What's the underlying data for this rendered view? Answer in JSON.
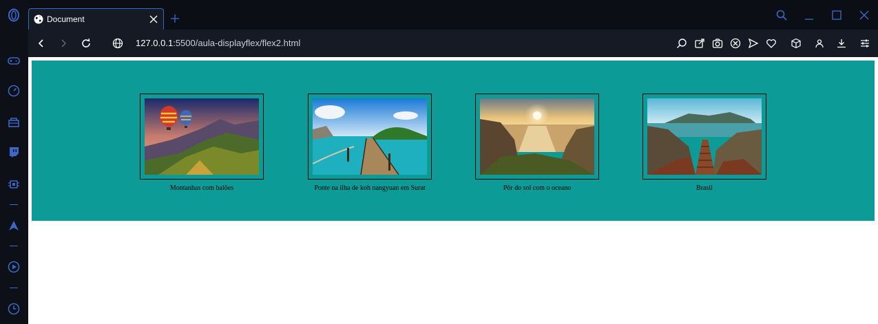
{
  "browser": {
    "tab_title": "Document",
    "url_host": "127.0.0.1",
    "url_path": ":5500/aula-displayflex/flex2.html",
    "accent": "#3b67c9"
  },
  "sidebar": {
    "icons": [
      "opera-logo-icon",
      "gamepad-icon",
      "speed-dial-icon",
      "shopping-bag-icon",
      "twitch-icon",
      "chip-icon",
      "aria-icon",
      "player-icon",
      "history-icon"
    ]
  },
  "toolbar": {
    "icons": [
      "search-page-icon",
      "share-icon",
      "snapshot-icon",
      "adblock-icon",
      "send-icon",
      "heart-icon",
      "cube-icon",
      "profile-icon",
      "download-icon",
      "settings-sliders-icon"
    ]
  },
  "page": {
    "background": "#0d9b97",
    "cards": [
      {
        "caption": "Montanhas com balões",
        "photo": "hot-air-balloons-mountains"
      },
      {
        "caption": "Ponte na ilha de koh nangyuan em Surat",
        "photo": "pier-island"
      },
      {
        "caption": "Pôr do sol com o oceano",
        "photo": "ocean-sunset"
      },
      {
        "caption": "Brasil",
        "photo": "stairs-to-beach"
      }
    ]
  }
}
